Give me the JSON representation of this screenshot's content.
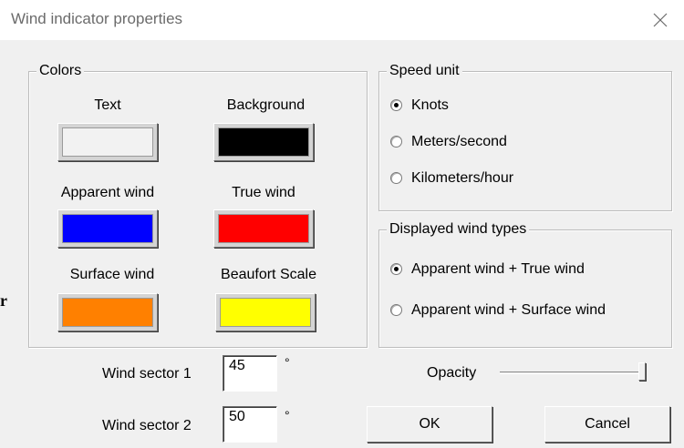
{
  "window": {
    "title": "Wind indicator properties",
    "close_icon": "close-icon"
  },
  "colors_group": {
    "legend": "Colors",
    "items": [
      {
        "label": "Text",
        "color": "#f2f2f2"
      },
      {
        "label": "Background",
        "color": "#000000"
      },
      {
        "label": "Apparent wind",
        "color": "#0000ff"
      },
      {
        "label": "True wind",
        "color": "#ff0000"
      },
      {
        "label": "Surface wind",
        "color": "#ff8000"
      },
      {
        "label": "Beaufort Scale",
        "color": "#ffff00"
      }
    ]
  },
  "speed_unit_group": {
    "legend": "Speed unit",
    "options": [
      {
        "label": "Knots",
        "selected": true
      },
      {
        "label": "Meters/second",
        "selected": false
      },
      {
        "label": "Kilometers/hour",
        "selected": false
      }
    ]
  },
  "wind_types_group": {
    "legend": "Displayed wind types",
    "options": [
      {
        "label": "Apparent wind + True wind",
        "selected": true
      },
      {
        "label": "Apparent wind + Surface wind",
        "selected": false
      }
    ]
  },
  "wind_sector_1": {
    "label": "Wind sector 1",
    "value": "45",
    "unit": "°"
  },
  "wind_sector_2": {
    "label": "Wind sector 2",
    "value": "50",
    "unit": "°"
  },
  "opacity": {
    "label": "Opacity",
    "value_fraction": 1.0
  },
  "buttons": {
    "ok": "OK",
    "cancel": "Cancel"
  },
  "stray_char": "r"
}
